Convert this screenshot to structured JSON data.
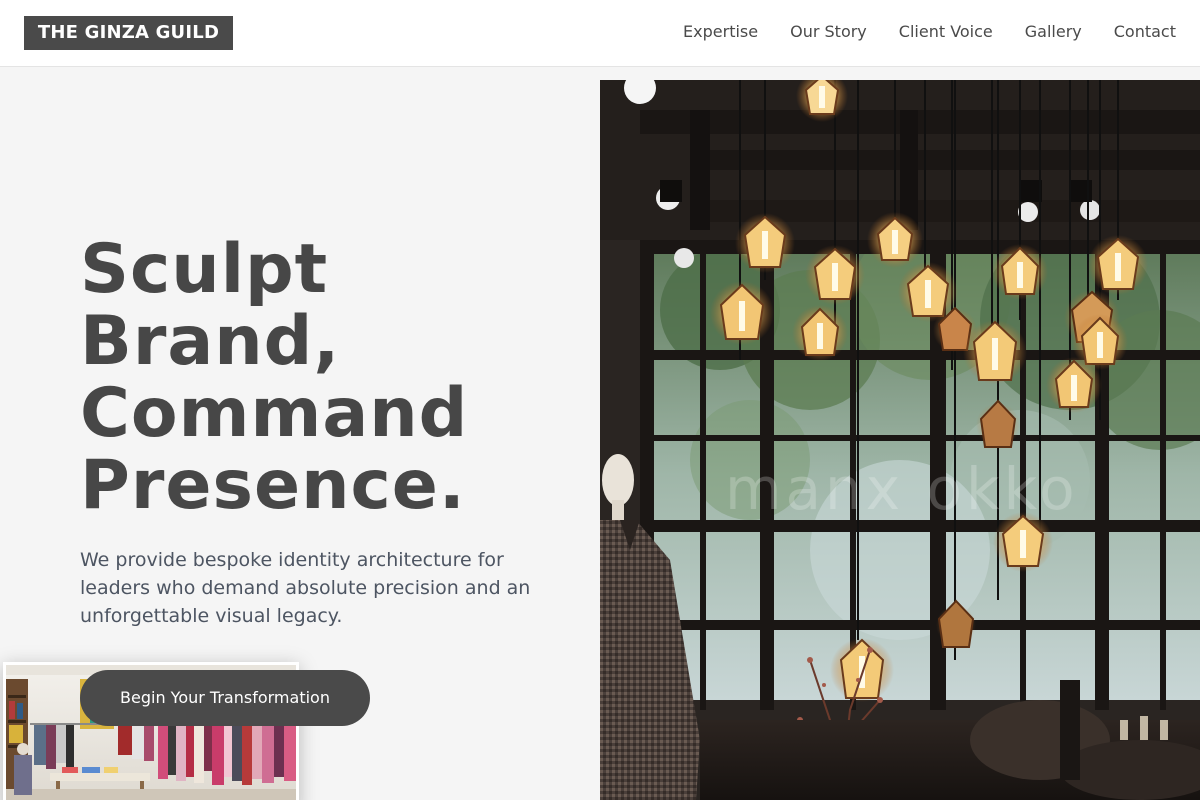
{
  "brand": {
    "logo_text": "THE GINZA GUILD",
    "logo_bg": "#4a4a4a",
    "text_color": "#474747",
    "page_bg": "#f5f5f5"
  },
  "nav": {
    "items": [
      "Expertise",
      "Our Story",
      "Client Voice",
      "Gallery",
      "Contact"
    ]
  },
  "hero": {
    "headline_lines": [
      "Sculpt",
      "Brand,",
      "Command",
      "Presence."
    ],
    "subtext": "We provide bespoke identity architecture for leaders who demand absolute precision and an unforgettable visual legacy.",
    "cta_label": "Begin Your Transformation",
    "image_watermark": "manx okko",
    "image_subject": "cafe interior with hanging edison-bulb lanterns, mannequin in tweed coat, large paned windows",
    "thumbnail_subject": "boutique interior with clothing racks"
  }
}
